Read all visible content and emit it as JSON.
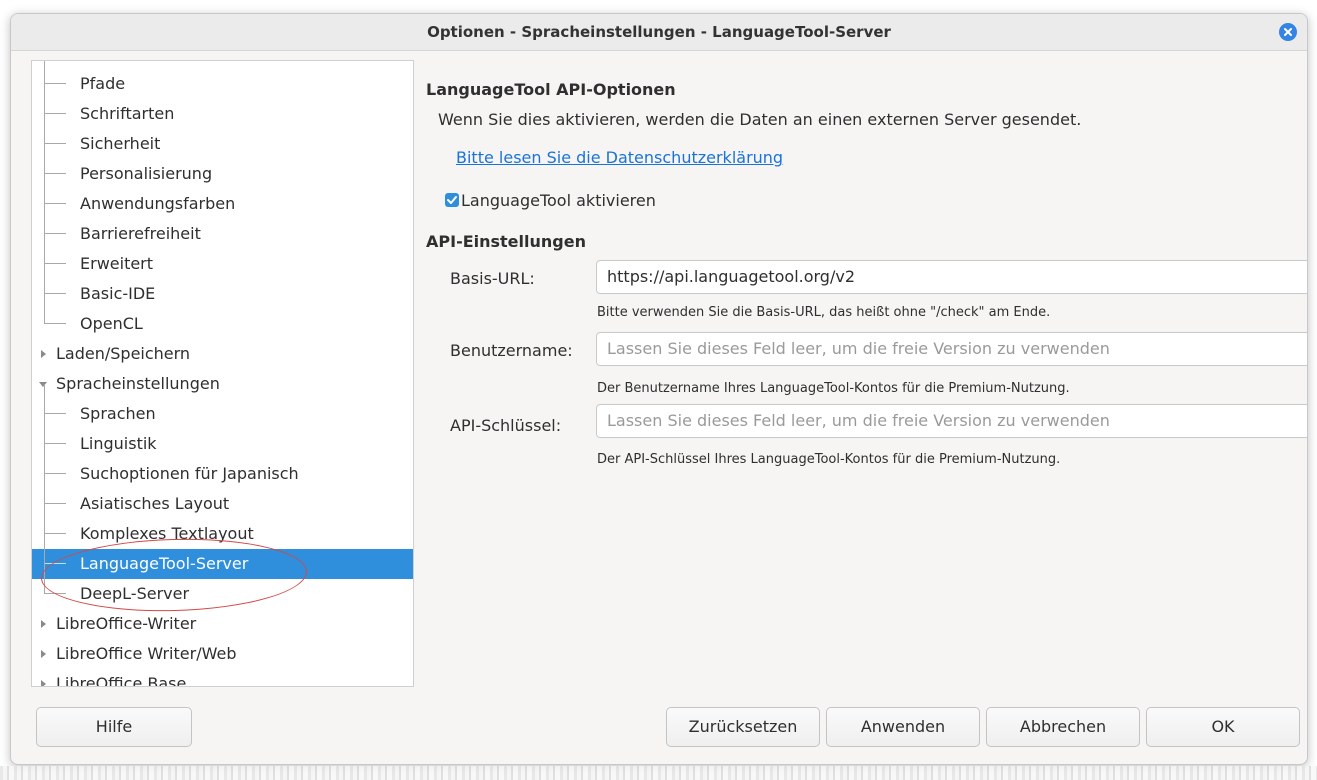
{
  "window": {
    "title": "Optionen - Spracheinstellungen - LanguageTool-Server"
  },
  "tree": {
    "items": [
      {
        "label": "Pfade",
        "level": "child"
      },
      {
        "label": "Schriftarten",
        "level": "child"
      },
      {
        "label": "Sicherheit",
        "level": "child"
      },
      {
        "label": "Personalisierung",
        "level": "child"
      },
      {
        "label": "Anwendungsfarben",
        "level": "child"
      },
      {
        "label": "Barrierefreiheit",
        "level": "child"
      },
      {
        "label": "Erweitert",
        "level": "child"
      },
      {
        "label": "Basic-IDE",
        "level": "child"
      },
      {
        "label": "OpenCL",
        "level": "child"
      },
      {
        "label": "Laden/Speichern",
        "level": "top",
        "expanded": false
      },
      {
        "label": "Spracheinstellungen",
        "level": "top",
        "expanded": true
      },
      {
        "label": "Sprachen",
        "level": "child"
      },
      {
        "label": "Linguistik",
        "level": "child"
      },
      {
        "label": "Suchoptionen für Japanisch",
        "level": "child"
      },
      {
        "label": "Asiatisches Layout",
        "level": "child"
      },
      {
        "label": "Komplexes Textlayout",
        "level": "child"
      },
      {
        "label": "LanguageTool-Server",
        "level": "child",
        "selected": true
      },
      {
        "label": "DeepL-Server",
        "level": "child"
      },
      {
        "label": "LibreOffice-Writer",
        "level": "top",
        "expanded": false
      },
      {
        "label": "LibreOffice Writer/Web",
        "level": "top",
        "expanded": false
      },
      {
        "label": "LibreOffice Base",
        "level": "top",
        "expanded": false
      }
    ]
  },
  "panel": {
    "api_options_heading": "LanguageTool API-Optionen",
    "notice": "Wenn Sie dies aktivieren, werden die Daten an einen externen Server gesendet.",
    "privacy_link": "Bitte lesen Sie die Datenschutzerklärung",
    "enable_checkbox": {
      "label": "LanguageTool aktivieren",
      "checked": true
    },
    "api_settings_heading": "API-Einstellungen",
    "base_url": {
      "label": "Basis-URL:",
      "value": "https://api.languagetool.org/v2",
      "hint": "Bitte verwenden Sie die Basis-URL, das heißt ohne \"/check\" am Ende."
    },
    "username": {
      "label": "Benutzername:",
      "placeholder": "Lassen Sie dieses Feld leer, um die freie Version zu verwenden",
      "hint": "Der Benutzername Ihres LanguageTool-Kontos für die Premium-Nutzung."
    },
    "api_key": {
      "label": "API-Schlüssel:",
      "placeholder": "Lassen Sie dieses Feld leer, um die freie Version zu verwenden",
      "hint": "Der API-Schlüssel Ihres LanguageTool-Kontos für die Premium-Nutzung."
    }
  },
  "buttons": {
    "help": "Hilfe",
    "reset": "Zurücksetzen",
    "apply": "Anwenden",
    "cancel": "Abbrechen",
    "ok": "OK"
  },
  "colors": {
    "accent": "#2f8fdc",
    "link": "#1a73d8",
    "annotation": "#d44848"
  }
}
